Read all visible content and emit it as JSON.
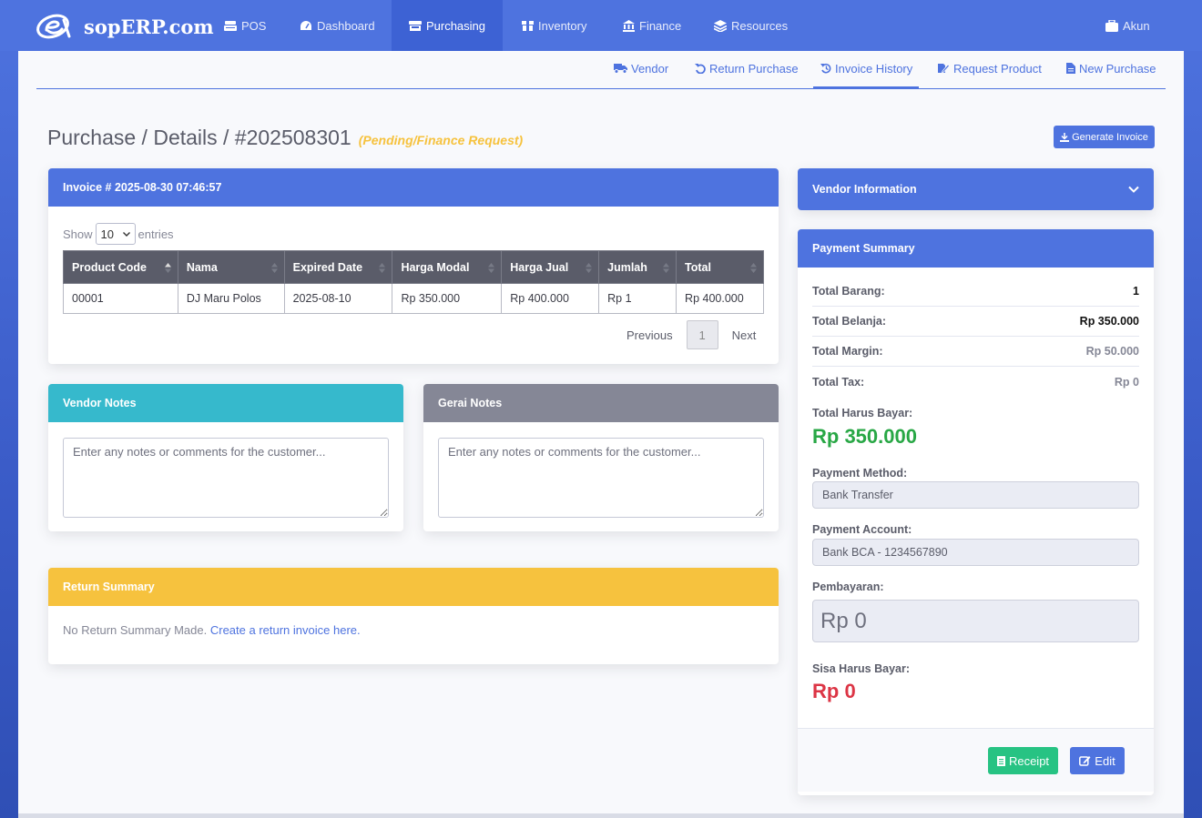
{
  "brand": {
    "name": "sopERP.com"
  },
  "nav": {
    "items": [
      {
        "label": "POS",
        "icon": "cash-register-icon"
      },
      {
        "label": "Dashboard",
        "icon": "tachometer-icon"
      },
      {
        "label": "Purchasing",
        "icon": "store-icon",
        "active": true
      },
      {
        "label": "Inventory",
        "icon": "box-icon"
      },
      {
        "label": "Finance",
        "icon": "bank-icon"
      },
      {
        "label": "Resources",
        "icon": "layers-icon"
      }
    ],
    "account": {
      "label": "Akun",
      "icon": "briefcase-icon"
    }
  },
  "subnav": {
    "items": [
      {
        "label": "Vendor",
        "icon": "truck-icon"
      },
      {
        "label": "Return Purchase",
        "icon": "undo-icon"
      },
      {
        "label": "Invoice History",
        "icon": "history-icon",
        "active": true
      },
      {
        "label": "Request Product",
        "icon": "edit-file-icon"
      },
      {
        "label": "New Purchase",
        "icon": "file-icon"
      }
    ]
  },
  "page": {
    "title": "Purchase / Details / #202508301",
    "status": "(Pending/Finance Request)",
    "generate_invoice_label": "Generate Invoice"
  },
  "invoice_card": {
    "title": "Invoice # 2025-08-30 07:46:57",
    "show_label": "Show",
    "entries_value": "10",
    "entries_label": "entries",
    "columns": [
      "Product Code",
      "Nama",
      "Expired Date",
      "Harga Modal",
      "Harga Jual",
      "Jumlah",
      "Total"
    ],
    "rows": [
      [
        "00001",
        "DJ Maru Polos",
        "2025-08-10",
        "Rp 350.000",
        "Rp 400.000",
        "Rp 1",
        "Rp 400.000"
      ]
    ],
    "pagination": {
      "previous": "Previous",
      "current": "1",
      "next": "Next"
    }
  },
  "vendor_notes": {
    "title": "Vendor Notes",
    "placeholder": "Enter any notes or comments for the customer..."
  },
  "gerai_notes": {
    "title": "Gerai Notes",
    "placeholder": "Enter any notes or comments for the customer..."
  },
  "return_summary": {
    "title": "Return Summary",
    "text": "No Return Summary Made.",
    "link": "Create a return invoice here."
  },
  "vendor_info": {
    "title": "Vendor Information"
  },
  "payment_summary": {
    "title": "Payment Summary",
    "rows": [
      {
        "label": "Total Barang:",
        "value": "1"
      },
      {
        "label": "Total Belanja:",
        "value": "Rp 350.000"
      },
      {
        "label": "Total Margin:",
        "value": "Rp 50.000"
      },
      {
        "label": "Total Tax:",
        "value": "Rp 0"
      }
    ],
    "total_label": "Total Harus Bayar:",
    "total_value": "Rp 350.000",
    "method_label": "Payment Method:",
    "method_value": "Bank Transfer",
    "account_label": "Payment Account:",
    "account_value": "Bank BCA - 1234567890",
    "pembayaran_label": "Pembayaran:",
    "pembayaran_value": "Rp 0",
    "sisa_label": "Sisa Harus Bayar:",
    "sisa_value": "Rp 0",
    "receipt_label": "Receipt",
    "edit_label": "Edit"
  },
  "colors": {
    "primary": "#4e73df",
    "success": "#1cc88a",
    "info": "#36b9cc",
    "secondary": "#858796",
    "warning": "#f6c23e",
    "danger": "#e74a3b"
  }
}
